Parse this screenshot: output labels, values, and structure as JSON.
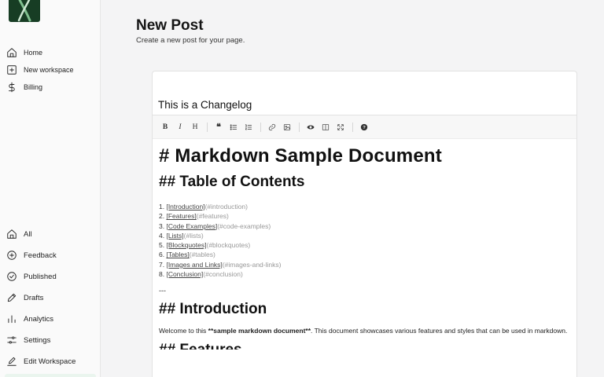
{
  "app": {
    "accent": "#173d24"
  },
  "sidebar": {
    "top_items": [
      {
        "label": "Home",
        "icon": "home-icon"
      },
      {
        "label": "New workspace",
        "icon": "plus-square-icon"
      },
      {
        "label": "Billing",
        "icon": "dollar-icon"
      }
    ],
    "lower_items": [
      {
        "label": "All",
        "icon": "home-icon"
      },
      {
        "label": "Feedback",
        "icon": "plus-circle-icon"
      },
      {
        "label": "Published",
        "icon": "check-circle-icon"
      },
      {
        "label": "Drafts",
        "icon": "pen-icon"
      },
      {
        "label": "Analytics",
        "icon": "bar-chart-icon"
      },
      {
        "label": "Settings",
        "icon": "sliders-icon"
      },
      {
        "label": "Edit Workspace",
        "icon": "edit-icon"
      }
    ]
  },
  "page": {
    "title": "New Post",
    "subtitle": "Create a new post for your page."
  },
  "editor": {
    "title_value": "This is a Changelog",
    "toolbar": [
      {
        "name": "bold",
        "glyph": "B"
      },
      {
        "name": "italic",
        "glyph": "I"
      },
      {
        "name": "heading",
        "glyph": "H"
      },
      {
        "name": "quote",
        "glyph": "❝"
      },
      {
        "name": "unordered-list",
        "icon": "list-icon"
      },
      {
        "name": "ordered-list",
        "icon": "ordered-list-icon"
      },
      {
        "name": "link",
        "icon": "link-icon"
      },
      {
        "name": "image",
        "icon": "image-icon"
      },
      {
        "name": "preview",
        "icon": "eye-icon"
      },
      {
        "name": "side-by-side",
        "icon": "columns-icon"
      },
      {
        "name": "fullscreen",
        "icon": "fullscreen-icon"
      },
      {
        "name": "guide",
        "icon": "help-icon"
      }
    ],
    "content": {
      "h1": "# Markdown Sample Document",
      "toc_heading": "## Table of Contents",
      "toc": [
        {
          "num": "1. ",
          "link": "[Introduction]",
          "anchor": "(#introduction)"
        },
        {
          "num": "2. ",
          "link": "[Features]",
          "anchor": "(#features)"
        },
        {
          "num": "3. ",
          "link": "[Code Examples]",
          "anchor": "(#code-examples)"
        },
        {
          "num": "4. ",
          "link": "[Lists]",
          "anchor": "(#lists)"
        },
        {
          "num": "5. ",
          "link": "[Blockquotes]",
          "anchor": "(#blockquotes)"
        },
        {
          "num": "6. ",
          "link": "[Tables]",
          "anchor": "(#tables)"
        },
        {
          "num": "7. ",
          "link": "[Images and Links]",
          "anchor": "(#images-and-links)"
        },
        {
          "num": "8. ",
          "link": "[Conclusion]",
          "anchor": "(#conclusion)"
        }
      ],
      "hr": "---",
      "intro_heading": "## Introduction",
      "intro_pre": "Welcome to this ",
      "intro_bold": "**sample markdown document**",
      "intro_post": ". This document showcases various features and styles that can be used in markdown.",
      "next_heading": "## Features"
    }
  }
}
